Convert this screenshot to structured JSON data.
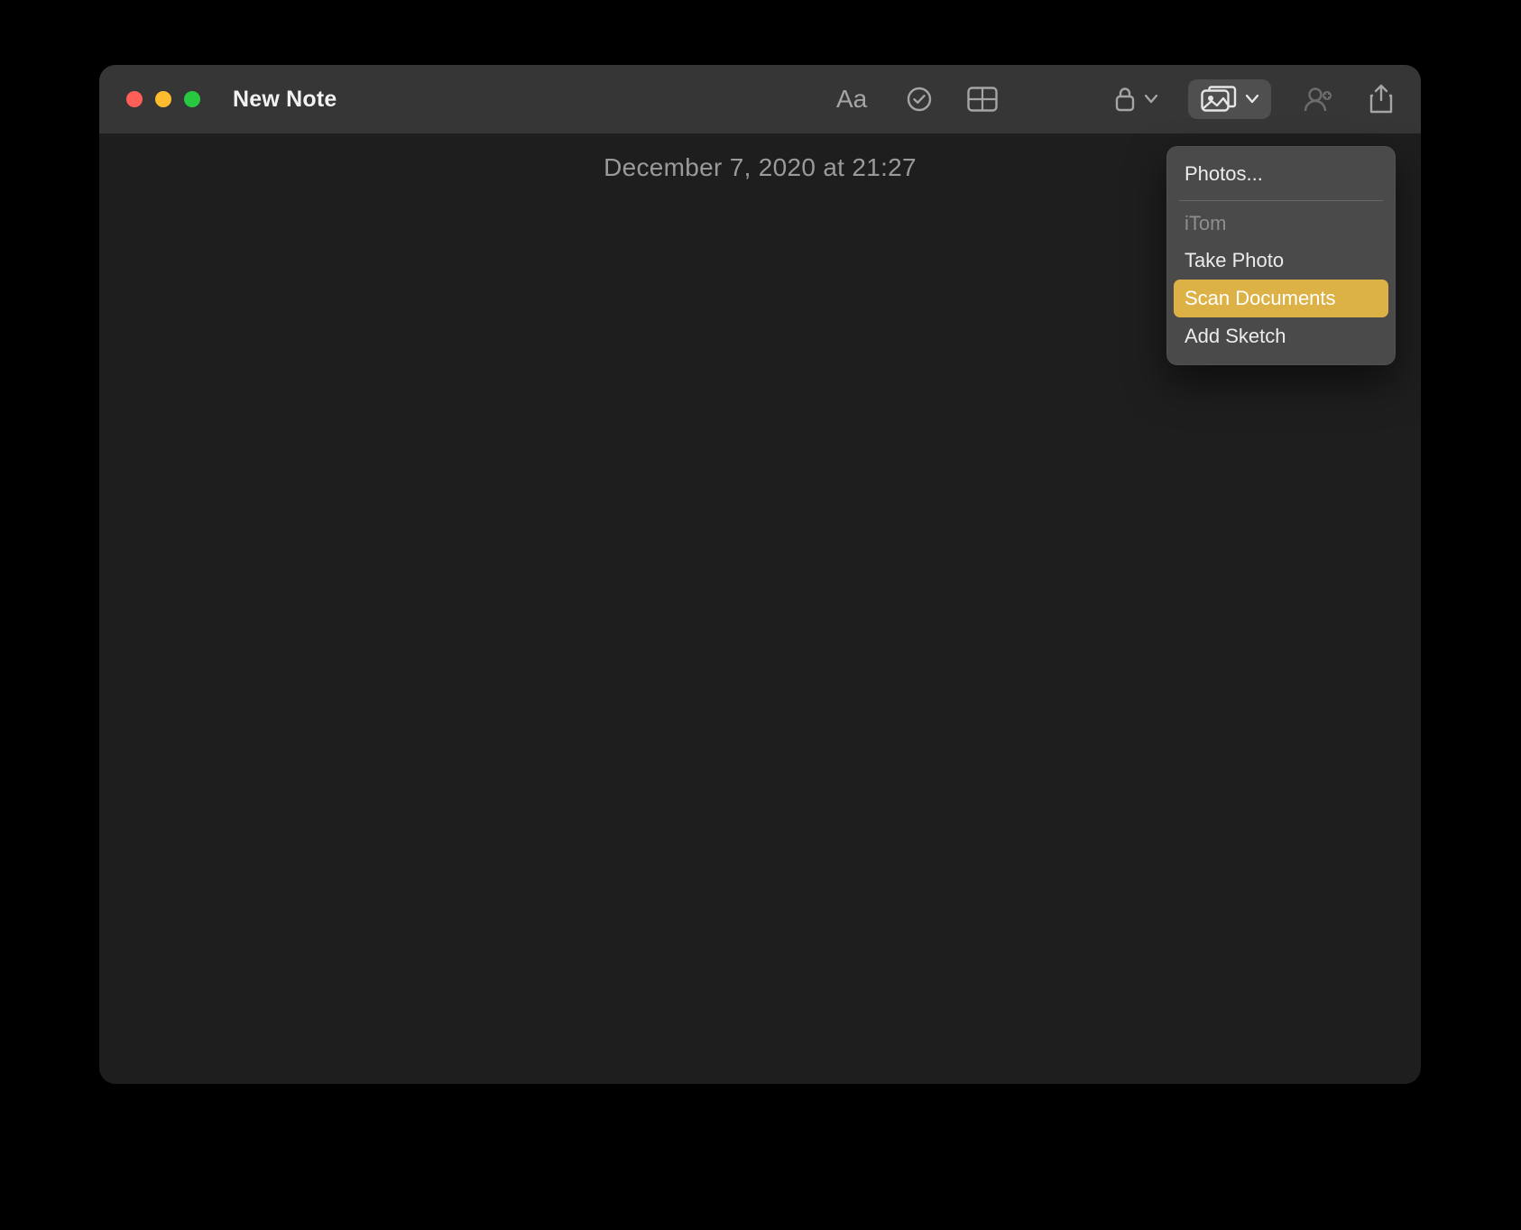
{
  "window": {
    "title": "New Note"
  },
  "note": {
    "timestamp": "December 7, 2020 at 21:27"
  },
  "media_menu": {
    "photos": "Photos...",
    "device_header": "iTom",
    "take_photo": "Take Photo",
    "scan_documents": "Scan Documents",
    "add_sketch": "Add Sketch"
  }
}
